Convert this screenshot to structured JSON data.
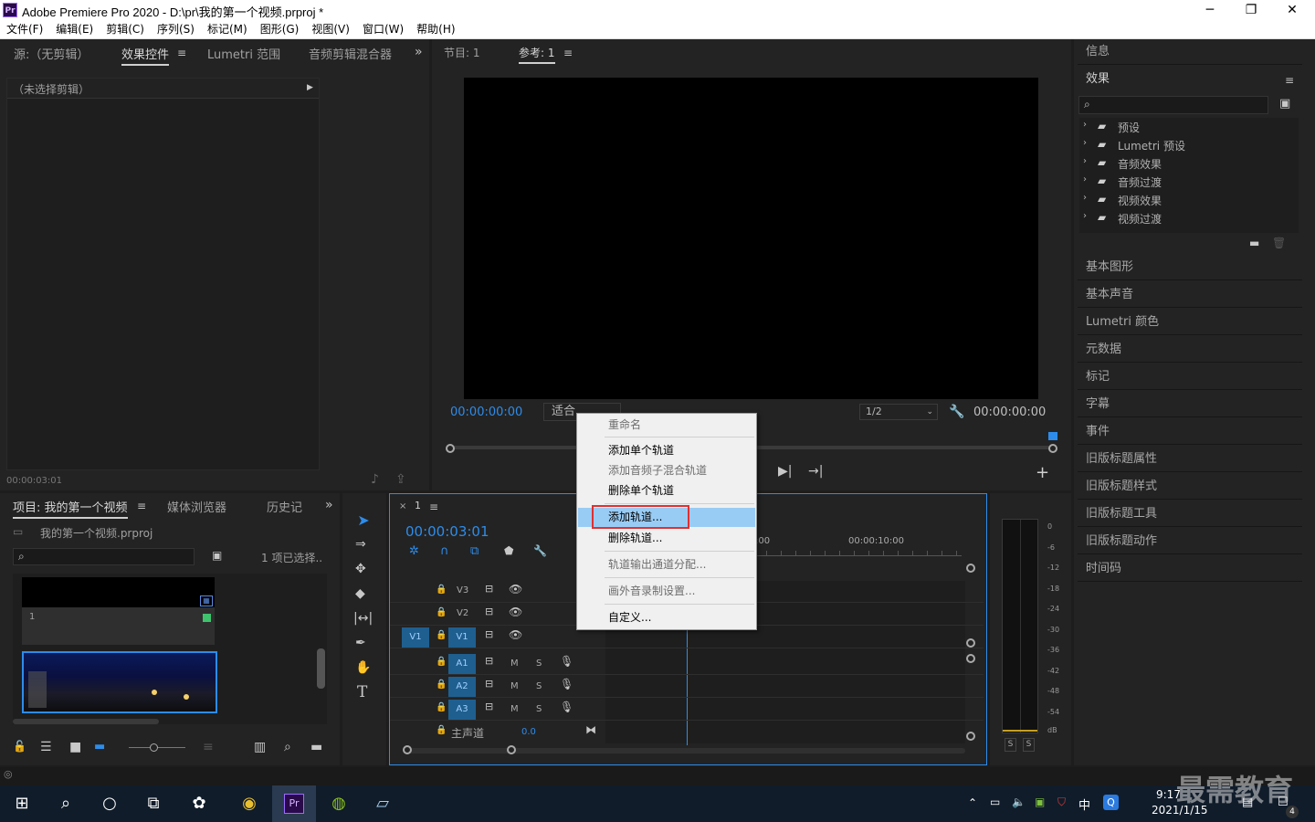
{
  "window": {
    "title": "Adobe Premiere Pro 2020 - D:\\pr\\我的第一个视频.prproj *",
    "logo": "Pr",
    "controls": [
      "─",
      "❐",
      "✕"
    ]
  },
  "menu": [
    "文件(F)",
    "编辑(E)",
    "剪辑(C)",
    "序列(S)",
    "标记(M)",
    "图形(G)",
    "视图(V)",
    "窗口(W)",
    "帮助(H)"
  ],
  "source_panel": {
    "tabs": [
      "源:（无剪辑）",
      "效果控件",
      "Lumetri 范围",
      "音频剪辑混合器"
    ],
    "no_clip": "（未选择剪辑）",
    "timecode": "00:00:03:01"
  },
  "program_panel": {
    "tabs": [
      "节目: 1",
      "参考: 1"
    ],
    "timecode_left": "00:00:00:00",
    "fit": "适合",
    "resolution": "1/2",
    "timecode_right": "00:00:00:00"
  },
  "project_panel": {
    "tabs": [
      "项目: 我的第一个视频",
      "媒体浏览器",
      "历史记"
    ],
    "file": "我的第一个视频.prproj",
    "selection": "1 项已选择..",
    "item1_label": "1"
  },
  "timeline": {
    "sequence": "1",
    "timecode": "00:00:03:01",
    "ruler_a": ":00",
    "ruler_b": "00:00:10:00",
    "video_tracks": [
      "V3",
      "V2",
      "V1"
    ],
    "audio_tracks": [
      "A1",
      "A2",
      "A3"
    ],
    "source_patch": "V1",
    "mute": "M",
    "solo": "S",
    "master": "主声道",
    "master_value": "0.0"
  },
  "meter": {
    "scale": [
      "0",
      "-6",
      "-12",
      "-18",
      "-24",
      "-30",
      "-36",
      "-42",
      "-48",
      "-54",
      "dB"
    ],
    "solo": [
      "S",
      "S"
    ]
  },
  "context_menu": {
    "items": [
      {
        "label": "重命名",
        "disabled": true
      },
      {
        "label": "添加单个轨道",
        "disabled": false
      },
      {
        "label": "添加音频子混合轨道",
        "disabled": true
      },
      {
        "label": "删除单个轨道",
        "disabled": false
      },
      {
        "label": "添加轨道...",
        "disabled": false,
        "highlighted": true
      },
      {
        "label": "删除轨道...",
        "disabled": false
      },
      {
        "label": "轨道输出通道分配...",
        "disabled": true
      },
      {
        "label": "画外音录制设置...",
        "disabled": true
      },
      {
        "label": "自定义...",
        "disabled": false
      }
    ]
  },
  "right_panel": {
    "info": "信息",
    "effects": "效果",
    "effect_folders": [
      "预设",
      "Lumetri 预设",
      "音频效果",
      "音频过渡",
      "视频效果",
      "视频过渡"
    ],
    "sections": [
      "基本图形",
      "基本声音",
      "Lumetri 颜色",
      "元数据",
      "标记",
      "字幕",
      "事件",
      "旧版标题属性",
      "旧版标题样式",
      "旧版标题工具",
      "旧版标题动作",
      "时间码"
    ]
  },
  "taskbar": {
    "time": "9:17",
    "date": "2021/1/15",
    "ime": "中",
    "notif_count": "4",
    "watermark": "最需教育"
  },
  "colors": {
    "accent": "#2d8ceb",
    "highlight": "#99ccf5",
    "callout": "#e03030",
    "track_patch": "#1f5f8f"
  }
}
